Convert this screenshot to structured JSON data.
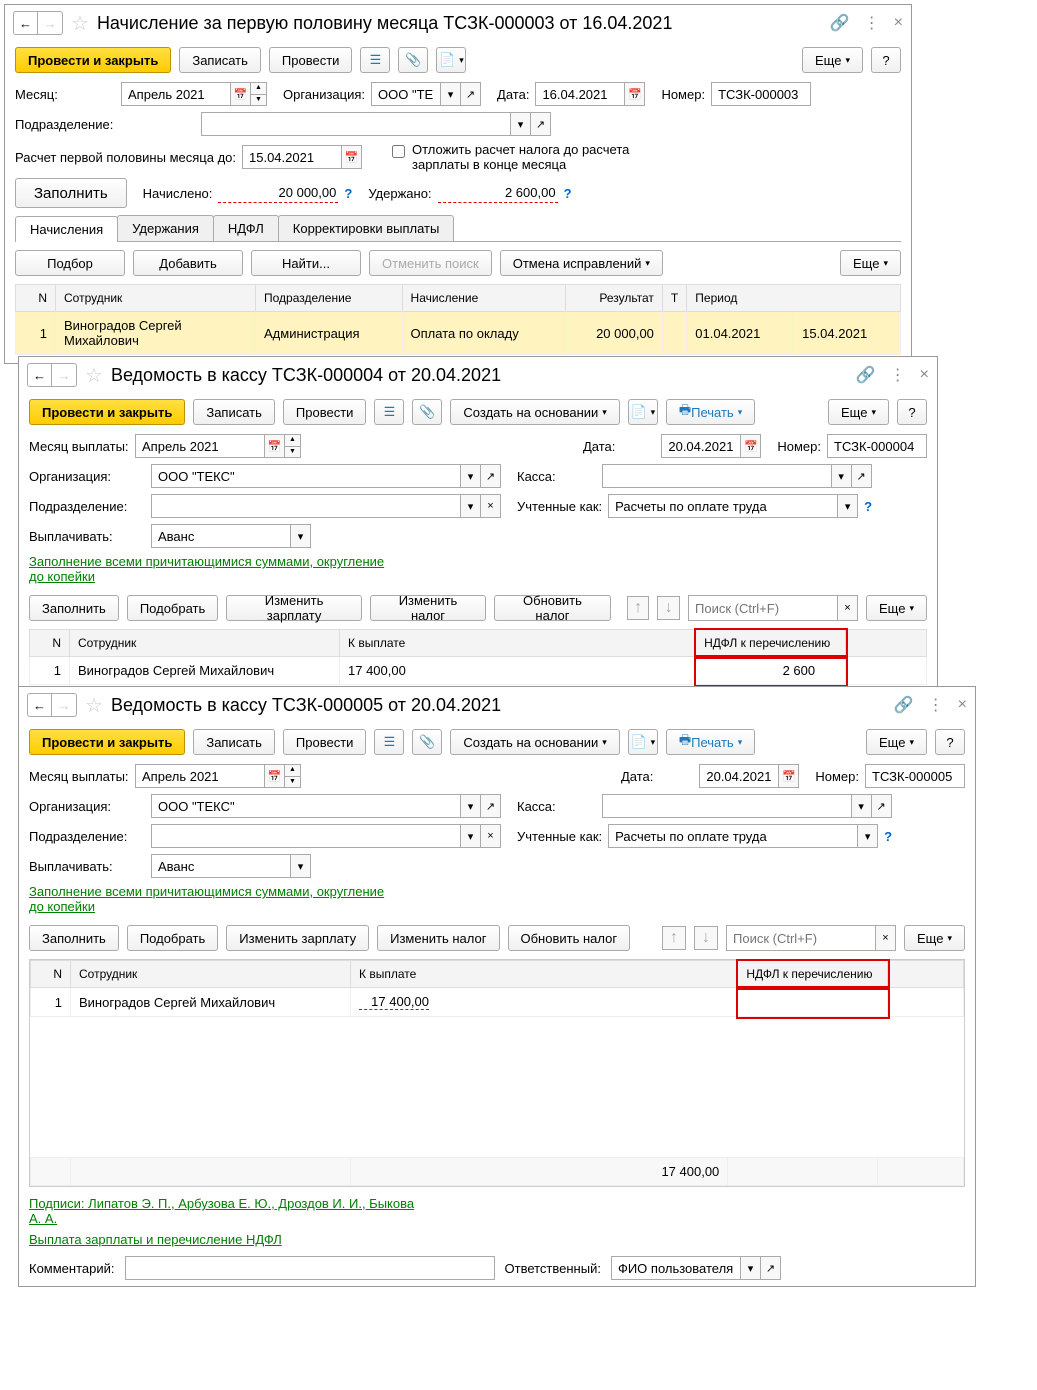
{
  "win1": {
    "title": "Начисление за первую половину месяца ТСЗК-000003 от 16.04.2021",
    "btn_post_close": "Провести и закрыть",
    "btn_save": "Записать",
    "btn_post": "Провести",
    "btn_more": "Еще",
    "lbl_month": "Месяц:",
    "month": "Апрель 2021",
    "lbl_org": "Организация:",
    "org": "ООО \"ТЕК",
    "lbl_date": "Дата:",
    "date": "16.04.2021",
    "lbl_num": "Номер:",
    "num": "ТСЗК-000003",
    "lbl_dept": "Подразделение:",
    "lbl_calc_to": "Расчет первой половины месяца до:",
    "calc_to": "15.04.2021",
    "chk_defer": "Отложить расчет налога до расчета зарплаты в конце месяца",
    "btn_fill": "Заполнить",
    "lbl_accrued": "Начислено:",
    "accrued": "20 000,00",
    "lbl_withheld": "Удержано:",
    "withheld": "2 600,00",
    "tabs": [
      "Начисления",
      "Удержания",
      "НДФЛ",
      "Корректировки выплаты"
    ],
    "btn_select": "Подбор",
    "btn_add": "Добавить",
    "btn_find": "Найти...",
    "btn_cancel_search": "Отменить поиск",
    "btn_cancel_fix": "Отмена исправлений",
    "cols": [
      "N",
      "Сотрудник",
      "Подразделение",
      "Начисление",
      "Результат",
      "Т",
      "Период",
      ""
    ],
    "row": [
      "1",
      "Виноградов Сергей Михайлович",
      "Администрация",
      "Оплата по окладу",
      "20 000,00",
      "",
      "01.04.2021",
      "15.04.2021"
    ]
  },
  "win2": {
    "title": "Ведомость в кассу ТСЗК-000004 от 20.04.2021",
    "btn_post_close": "Провести и закрыть",
    "btn_save": "Записать",
    "btn_post": "Провести",
    "btn_create": "Создать на основании",
    "btn_print": "Печать",
    "btn_more": "Еще",
    "lbl_month": "Месяц выплаты:",
    "month": "Апрель 2021",
    "lbl_date": "Дата:",
    "date": "20.04.2021",
    "lbl_num": "Номер:",
    "num": "ТСЗК-000004",
    "lbl_org": "Организация:",
    "org": "ООО \"ТЕКС\"",
    "lbl_kassa": "Касса:",
    "lbl_dept": "Подразделение:",
    "lbl_acct": "Учтенные как:",
    "acct": "Расчеты по оплате труда",
    "lbl_pay": "Выплачивать:",
    "pay": "Аванс",
    "link_fill": "Заполнение всеми причитающимися суммами, округление до копейки",
    "btn_fill": "Заполнить",
    "btn_pick": "Подобрать",
    "btn_chg_sal": "Изменить зарплату",
    "btn_chg_tax": "Изменить налог",
    "btn_upd_tax": "Обновить налог",
    "search_ph": "Поиск (Ctrl+F)",
    "cols": [
      "N",
      "Сотрудник",
      "К выплате",
      "НДФЛ к перечислению"
    ],
    "row": [
      "1",
      "Виноградов Сергей Михайлович",
      "17 400,00",
      "2 600"
    ]
  },
  "win3": {
    "title": "Ведомость в кассу ТСЗК-000005 от 20.04.2021",
    "btn_post_close": "Провести и закрыть",
    "btn_save": "Записать",
    "btn_post": "Провести",
    "btn_create": "Создать на основании",
    "btn_print": "Печать",
    "btn_more": "Еще",
    "lbl_month": "Месяц выплаты:",
    "month": "Апрель 2021",
    "lbl_date": "Дата:",
    "date": "20.04.2021",
    "lbl_num": "Номер:",
    "num": "ТСЗК-000005",
    "lbl_org": "Организация:",
    "org": "ООО \"ТЕКС\"",
    "lbl_kassa": "Касса:",
    "lbl_dept": "Подразделение:",
    "lbl_acct": "Учтенные как:",
    "acct": "Расчеты по оплате труда",
    "lbl_pay": "Выплачивать:",
    "pay": "Аванс",
    "link_fill": "Заполнение всеми причитающимися суммами, округление до копейки",
    "btn_fill": "Заполнить",
    "btn_pick": "Подобрать",
    "btn_chg_sal": "Изменить зарплату",
    "btn_chg_tax": "Изменить налог",
    "btn_upd_tax": "Обновить налог",
    "search_ph": "Поиск (Ctrl+F)",
    "cols": [
      "N",
      "Сотрудник",
      "К выплате",
      "НДФЛ к перечислению"
    ],
    "row": [
      "1",
      "Виноградов Сергей Михайлович",
      "17 400,00",
      ""
    ],
    "total": "17 400,00",
    "link_signers": "Подписи: Липатов Э. П., Арбузова Е. Ю., Дроздов И. И., Быкова А. А.",
    "link_ndfl": "Выплата зарплаты и перечисление НДФЛ",
    "lbl_comment": "Комментарий:",
    "lbl_resp": "Ответственный:",
    "resp": "ФИО пользователя"
  }
}
